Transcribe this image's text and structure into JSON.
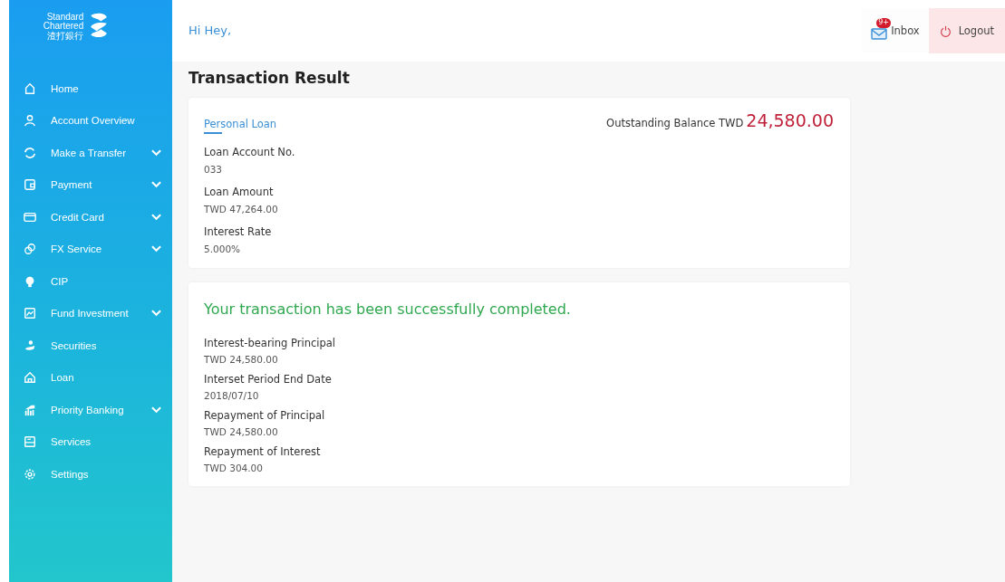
{
  "logo": {
    "line_1": "Standard",
    "line_2": "Chartered",
    "line_3": "渣打銀行"
  },
  "sidebar": {
    "items": [
      {
        "label": "Home",
        "submenu": false
      },
      {
        "label": "Account Overview",
        "submenu": false
      },
      {
        "label": "Make a Transfer",
        "submenu": true
      },
      {
        "label": "Payment",
        "submenu": true
      },
      {
        "label": "Credit Card",
        "submenu": true
      },
      {
        "label": "FX Service",
        "submenu": true
      },
      {
        "label": "CIP",
        "submenu": false
      },
      {
        "label": "Fund Investment",
        "submenu": true
      },
      {
        "label": "Securities",
        "submenu": false
      },
      {
        "label": "Loan",
        "submenu": false
      },
      {
        "label": "Priority Banking",
        "submenu": true
      },
      {
        "label": "Services",
        "submenu": false
      },
      {
        "label": "Settings",
        "submenu": false
      }
    ]
  },
  "header": {
    "greeting": "Hi Hey,",
    "inbox": {
      "label": "Inbox",
      "badge": "9+"
    },
    "logout": "Logout"
  },
  "page_title": "Transaction Result",
  "loan_card": {
    "tab": "Personal Loan",
    "balance_label": "Outstanding Balance TWD",
    "balance": "24,580.00",
    "fields": [
      {
        "label": "Loan Account No.",
        "value": "033"
      },
      {
        "label": "Loan Amount",
        "value": "TWD 47,264.00"
      },
      {
        "label": "Interest Rate",
        "value": "5.000%"
      }
    ]
  },
  "result_card": {
    "message": "Your transaction has been successfully completed.",
    "fields": [
      {
        "label": "Interest-bearing Principal",
        "value": "TWD 24,580.00"
      },
      {
        "label": "Interset Period End Date",
        "value": "2018/07/10"
      },
      {
        "label": "Repayment of Principal",
        "value": "TWD 24,580.00"
      },
      {
        "label": "Repayment of Interest",
        "value": "TWD 304.00"
      }
    ]
  }
}
